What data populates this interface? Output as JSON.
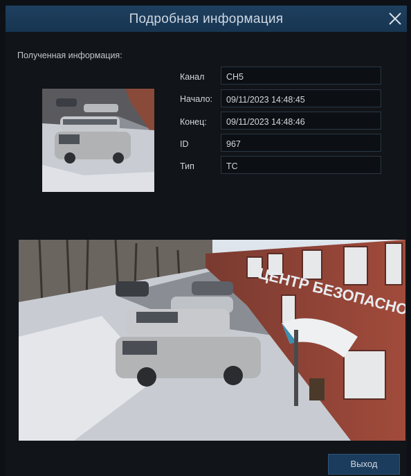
{
  "dialog": {
    "title": "Подробная информация",
    "close_icon": "close-icon"
  },
  "info": {
    "heading": "Полученная информация:"
  },
  "fields": [
    {
      "label": "Канал",
      "value": "CH5"
    },
    {
      "label": "Начало:",
      "value": "09/11/2023 14:48:45"
    },
    {
      "label": "Конец:",
      "value": "09/11/2023 14:48:46"
    },
    {
      "label": "ID",
      "value": "967"
    },
    {
      "label": "Тип",
      "value": "TC"
    }
  ],
  "building_sign": "ЦЕНТР БЕЗОПАСНОС",
  "buttons": {
    "exit": "Выход"
  },
  "colors": {
    "titlebar": "#1a3a58",
    "button": "#1b3c5c",
    "background": "#111418"
  }
}
